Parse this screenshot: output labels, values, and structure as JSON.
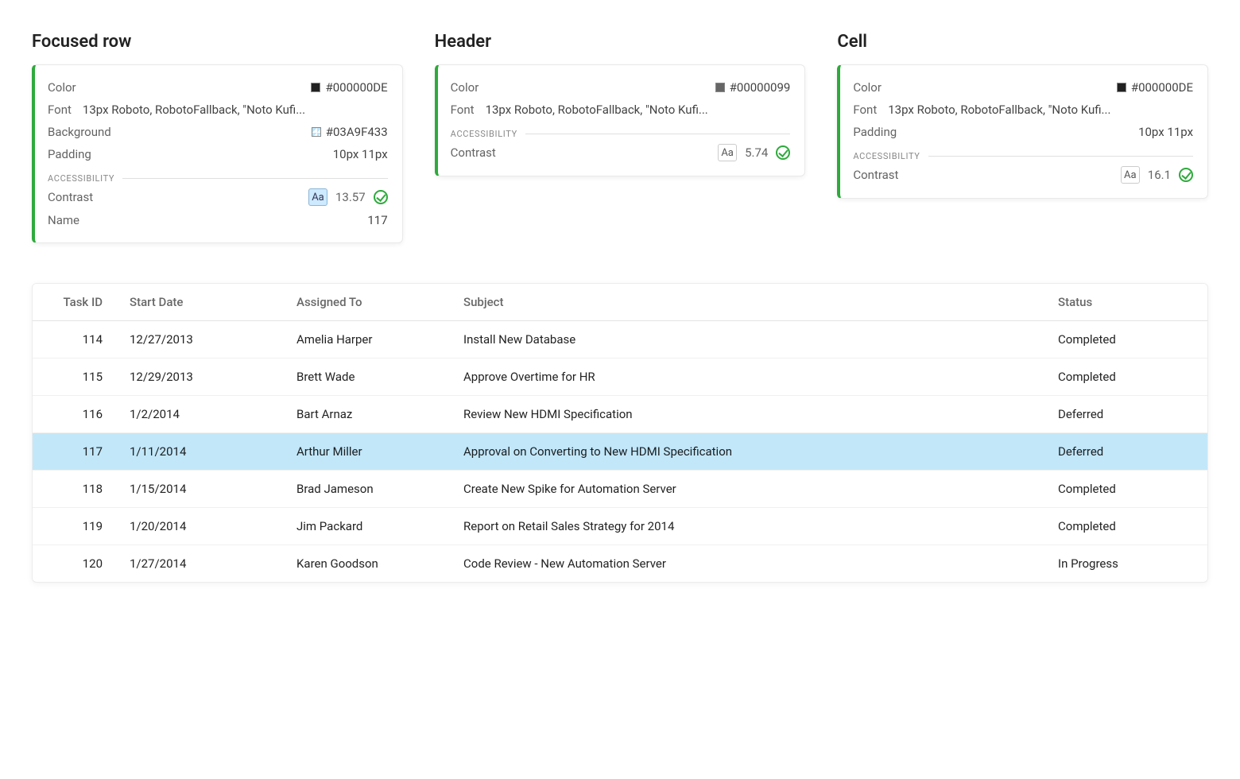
{
  "cards": [
    {
      "title": "Focused row",
      "props": {
        "color_label": "Color",
        "color_value": "#000000DE",
        "color_swatch_css": "rgba(0,0,0,0.87)",
        "font_label": "Font",
        "font_value": "13px Roboto, RobotoFallback, \"Noto Kufi...",
        "background_label": "Background",
        "background_value": "#03A9F433",
        "padding_label": "Padding",
        "padding_value": "10px 11px"
      },
      "has_background": true,
      "accessibility": {
        "heading": "ACCESSIBILITY",
        "contrast_label": "Contrast",
        "aa_text": "Aa",
        "aa_highlight": true,
        "contrast_value": "13.57",
        "name_label": "Name",
        "name_value": "117",
        "has_name": true
      }
    },
    {
      "title": "Header",
      "props": {
        "color_label": "Color",
        "color_value": "#00000099",
        "color_swatch_css": "rgba(0,0,0,0.6)",
        "font_label": "Font",
        "font_value": "13px Roboto, RobotoFallback, \"Noto Kufi...",
        "padding_label": "",
        "padding_value": ""
      },
      "has_background": false,
      "has_padding": false,
      "accessibility": {
        "heading": "ACCESSIBILITY",
        "contrast_label": "Contrast",
        "aa_text": "Aa",
        "aa_highlight": false,
        "contrast_value": "5.74",
        "has_name": false
      }
    },
    {
      "title": "Cell",
      "props": {
        "color_label": "Color",
        "color_value": "#000000DE",
        "color_swatch_css": "rgba(0,0,0,0.87)",
        "font_label": "Font",
        "font_value": "13px Roboto, RobotoFallback, \"Noto Kufi...",
        "padding_label": "Padding",
        "padding_value": "10px 11px"
      },
      "has_background": false,
      "has_padding": true,
      "accessibility": {
        "heading": "ACCESSIBILITY",
        "contrast_label": "Contrast",
        "aa_text": "Aa",
        "aa_highlight": false,
        "contrast_value": "16.1",
        "has_name": false
      }
    }
  ],
  "table": {
    "columns": [
      {
        "key": "task_id",
        "label": "Task ID",
        "cls": "col-id"
      },
      {
        "key": "start_date",
        "label": "Start Date",
        "cls": "col-date"
      },
      {
        "key": "assigned_to",
        "label": "Assigned To",
        "cls": "col-assigned"
      },
      {
        "key": "subject",
        "label": "Subject",
        "cls": "col-subject"
      },
      {
        "key": "status",
        "label": "Status",
        "cls": "col-status"
      }
    ],
    "rows": [
      {
        "task_id": "114",
        "start_date": "12/27/2013",
        "assigned_to": "Amelia Harper",
        "subject": "Install New Database",
        "status": "Completed",
        "focused": false
      },
      {
        "task_id": "115",
        "start_date": "12/29/2013",
        "assigned_to": "Brett Wade",
        "subject": "Approve Overtime for HR",
        "status": "Completed",
        "focused": false
      },
      {
        "task_id": "116",
        "start_date": "1/2/2014",
        "assigned_to": "Bart Arnaz",
        "subject": "Review New HDMI Specification",
        "status": "Deferred",
        "focused": false
      },
      {
        "task_id": "117",
        "start_date": "1/11/2014",
        "assigned_to": "Arthur Miller",
        "subject": "Approval on Converting to New HDMI Specification",
        "status": "Deferred",
        "focused": true
      },
      {
        "task_id": "118",
        "start_date": "1/15/2014",
        "assigned_to": "Brad Jameson",
        "subject": "Create New Spike for Automation Server",
        "status": "Completed",
        "focused": false
      },
      {
        "task_id": "119",
        "start_date": "1/20/2014",
        "assigned_to": "Jim Packard",
        "subject": "Report on Retail Sales Strategy for 2014",
        "status": "Completed",
        "focused": false
      },
      {
        "task_id": "120",
        "start_date": "1/27/2014",
        "assigned_to": "Karen Goodson",
        "subject": "Code Review - New Automation Server",
        "status": "In Progress",
        "focused": false
      }
    ]
  }
}
